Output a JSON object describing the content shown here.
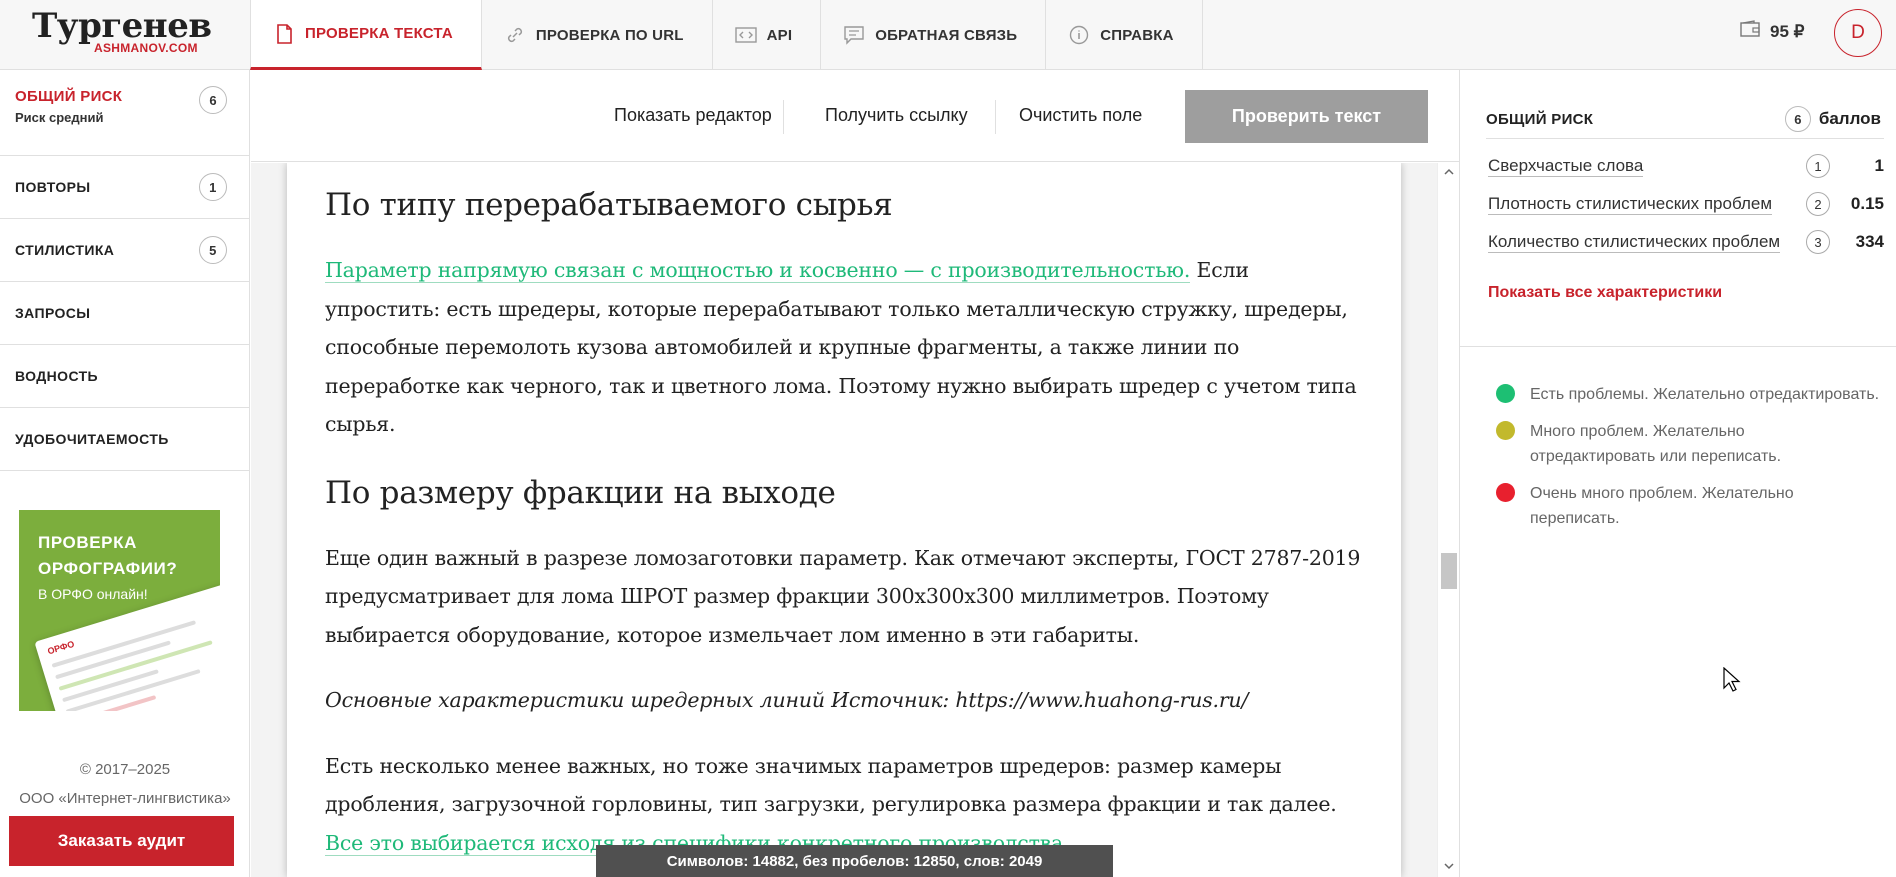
{
  "header": {
    "logo_title": "Тургенев",
    "logo_sub": "ASHMANOV.COM",
    "tabs": [
      {
        "label": "ПРОВЕРКА ТЕКСТА",
        "active": true,
        "icon": "document-icon"
      },
      {
        "label": "ПРОВЕРКА ПО URL",
        "active": false,
        "icon": "link-icon"
      },
      {
        "label": "API",
        "active": false,
        "icon": "code-icon"
      },
      {
        "label": "ОБРАТНАЯ СВЯЗЬ",
        "active": false,
        "icon": "chat-icon"
      },
      {
        "label": "СПРАВКА",
        "active": false,
        "icon": "info-icon"
      }
    ],
    "balance": "95 ₽",
    "user_initial": "D"
  },
  "sidebar": {
    "risk": {
      "title": "ОБЩИЙ РИСК",
      "subtitle": "Риск средний",
      "count": "6"
    },
    "items": [
      {
        "label": "ПОВТОРЫ",
        "count": "1"
      },
      {
        "label": "СТИЛИСТИКА",
        "count": "5"
      },
      {
        "label": "ЗАПРОСЫ",
        "count": ""
      },
      {
        "label": "ВОДНОСТЬ",
        "count": ""
      },
      {
        "label": "УДОБОЧИТАЕМОСТЬ",
        "count": ""
      }
    ],
    "promo": {
      "title_line1": "ПРОВЕРКА",
      "title_line2": "ОРФОГРАФИИ?",
      "subtitle": "В ОРФО онлайн!",
      "brand": "ОРФО"
    },
    "copyright_line1": "© 2017–2025",
    "copyright_line2": "ООО «Интернет-лингвистика»",
    "audit_button": "Заказать аудит"
  },
  "toolbar": {
    "show_editor": "Показать редактор",
    "get_link": "Получить ссылку",
    "clear_field": "Очистить поле",
    "check_text": "Проверить текст"
  },
  "document": {
    "heading1": "По типу перерабатываемого сырья",
    "p1_highlight": "Параметр напрямую связан с мощностью и косвенно — с производительностью.",
    "p1_rest": " Если упростить: есть шредеры, которые перерабатывают только металлическую стружку, шредеры, способные перемолоть кузова автомобилей и крупные фрагменты, а также линии по переработке как черного, так и цветного лома. Поэтому нужно выбирать шредер с учетом типа сырья.",
    "heading2": "По размеру фракции на выходе",
    "p2": "Еще один важный в разрезе ломозаготовки параметр. Как отмечают эксперты, ГОСТ 2787-2019 предусматривает для лома ШРОТ размер фракции 300х300х300 миллиметров. Поэтому выбирается оборудование, которое измельчает лом именно в эти габариты.",
    "p3_italic": "Основные характеристики шредерных линий Источник: https://www.huahong-rus.ru/",
    "p4_start": "Есть несколько менее важных, но тоже значимых параметров шредеров: размер камеры дробления, загрузочной горловины, тип загрузки, регулировка размера фракции и так далее. ",
    "p4_highlight": "Все это выбирается исходя из специфики конкретного производства."
  },
  "stats": "Символов: 14882, без пробелов: 12850, слов: 2049",
  "right_panel": {
    "title": "ОБЩИЙ РИСК",
    "score": "6",
    "score_label": "баллов",
    "metrics": [
      {
        "label": "Сверхчастые слова",
        "badge": "1",
        "value": "1"
      },
      {
        "label": "Плотность стилистических проблем",
        "badge": "2",
        "value": "0.15"
      },
      {
        "label": "Количество стилистических проблем",
        "badge": "3",
        "value": "334"
      }
    ],
    "show_all": "Показать все характеристики",
    "legend": [
      {
        "color": "#1dbf73",
        "text_line1": "Есть проблемы. Желательно отредактировать.",
        "text_line2": ""
      },
      {
        "color": "#c2b92c",
        "text_line1": "Много проблем. Желательно",
        "text_line2": "отредактировать или переписать."
      },
      {
        "color": "#e8202e",
        "text_line1": "Очень много проблем. Желательно",
        "text_line2": "переписать."
      }
    ]
  },
  "colors": {
    "accent": "#c8232c",
    "highlight": "#1fb979"
  }
}
